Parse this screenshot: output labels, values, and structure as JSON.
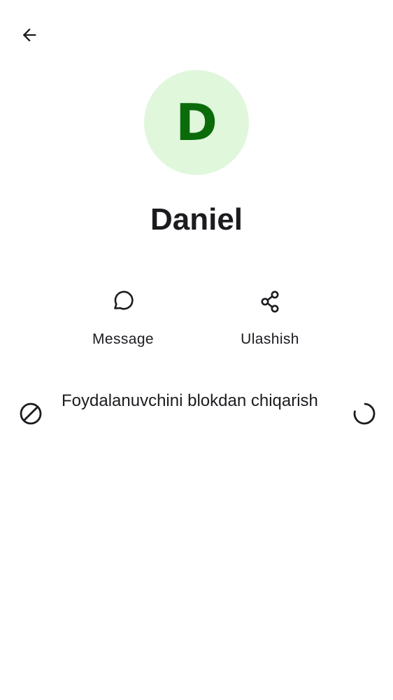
{
  "header": {
    "back_icon": "arrow-left-icon"
  },
  "profile": {
    "avatar_letter": "D",
    "avatar_bg": "#e0f7dc",
    "avatar_fg": "#0b6b0b",
    "name": "Daniel"
  },
  "actions": [
    {
      "label": "Message",
      "icon": "chat-bubble-icon"
    },
    {
      "label": "Ulashish",
      "icon": "share-icon"
    }
  ],
  "options": [
    {
      "label": "Foydalanuvchini blokdan chiqarish",
      "icon": "block-icon",
      "trailing": "loading-spinner-icon"
    }
  ]
}
